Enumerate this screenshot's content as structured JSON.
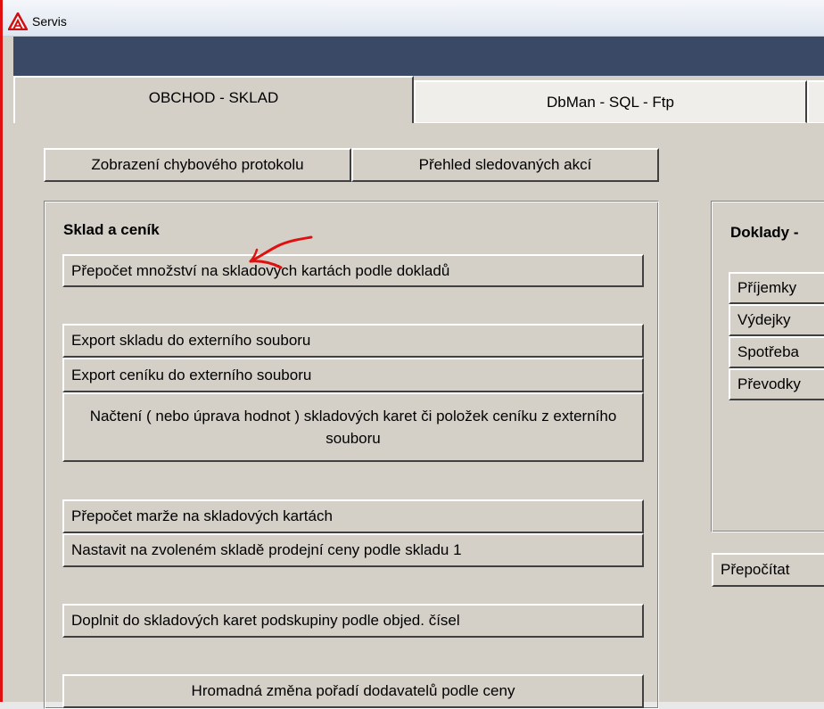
{
  "window": {
    "title": "Servis"
  },
  "tabs": [
    {
      "label": "OBCHOD - SKLAD"
    },
    {
      "label": "DbMan - SQL - Ftp"
    },
    {
      "label": ""
    }
  ],
  "toolbar": {
    "error_log_label": "Zobrazení chybového protokolu",
    "tracked_actions_label": "Přehled sledovaných akcí"
  },
  "sklad": {
    "title": "Sklad a ceník",
    "buttons": [
      "Přepočet množství na skladových kartách podle dokladů",
      "Export skladu do externího souboru",
      "Export ceníku do externího souboru",
      "Načtení  ( nebo úprava hodnot )  skladových karet či položek ceníku z externího souboru",
      "Přepočet marže na skladových kartách",
      "Nastavit na zvoleném skladě prodejní ceny podle skladu 1",
      "Doplnit do skladových karet podskupiny podle objed. čísel",
      "Hromadná změna pořadí dodavatelů podle ceny"
    ]
  },
  "doklady": {
    "title": "Doklady - ",
    "buttons": [
      "Příjemky",
      "Výdejky",
      "Spotřeba",
      "Převodky"
    ],
    "recalc_label": "Přepočítat"
  },
  "colors": {
    "window_border": "#e01010",
    "header_bar": "#3a4a66",
    "annotation": "#e01010"
  }
}
